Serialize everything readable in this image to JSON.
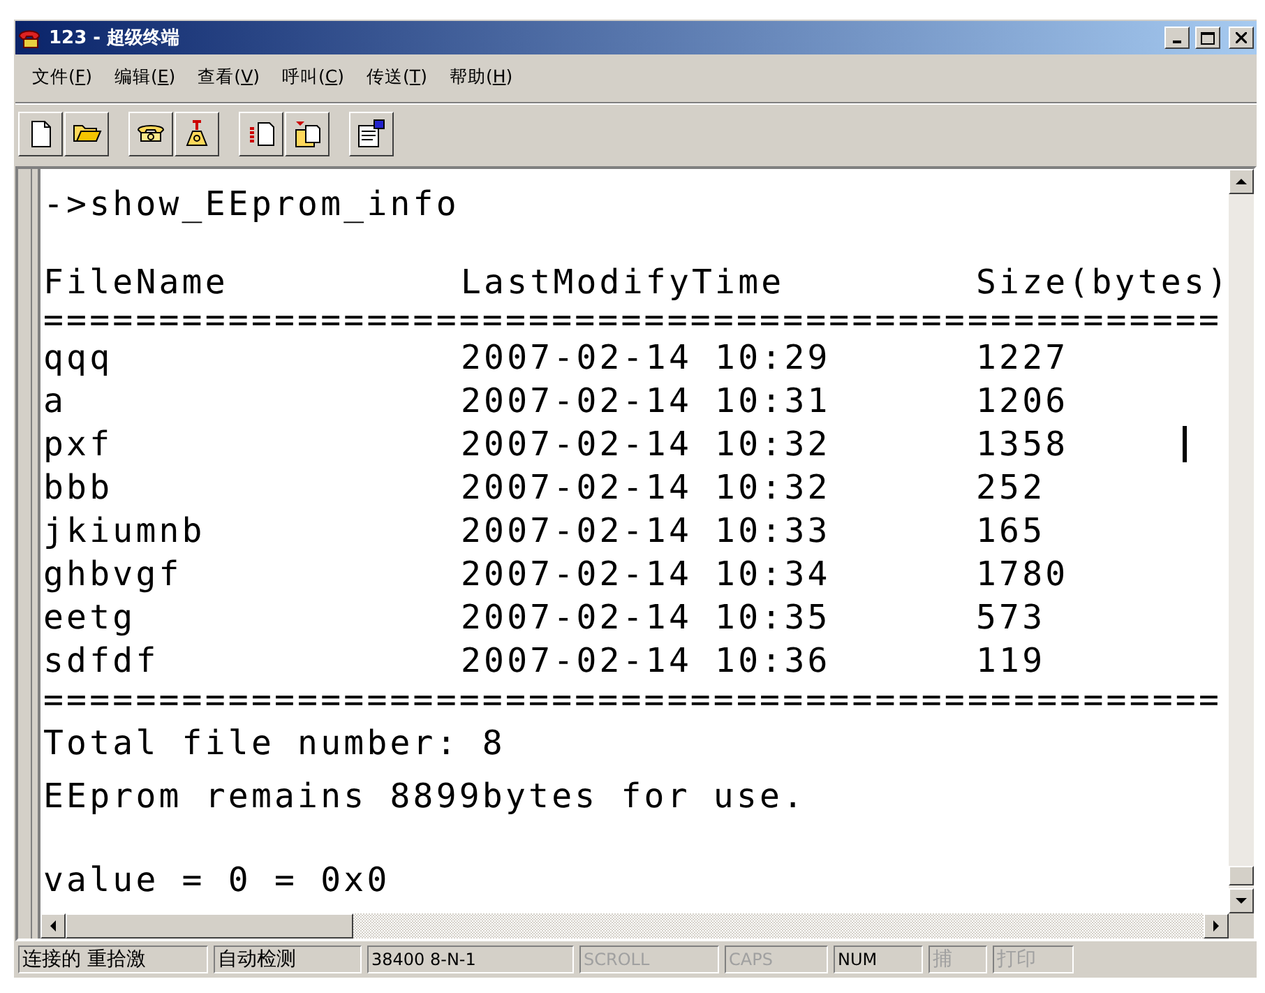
{
  "window": {
    "title": "123 - 超级终端"
  },
  "menu": [
    {
      "label": "文件(F)"
    },
    {
      "label": "编辑(E)"
    },
    {
      "label": "查看(V)"
    },
    {
      "label": "呼叫(C)"
    },
    {
      "label": "传送(T)"
    },
    {
      "label": "帮助(H)"
    }
  ],
  "terminal": {
    "lines": [
      {
        "kind": "text",
        "text": "->show_EEprom_info"
      },
      {
        "kind": "blank"
      },
      {
        "kind": "header",
        "cells": [
          "FileName",
          "LastModifyTime",
          "Size(bytes)"
        ]
      },
      {
        "kind": "rule",
        "text": "==================================================="
      },
      {
        "kind": "row",
        "cells": [
          "qqq",
          "2007-02-14 10:29",
          "1227"
        ]
      },
      {
        "kind": "row",
        "cells": [
          "a",
          "2007-02-14 10:31",
          "1206"
        ]
      },
      {
        "kind": "row",
        "cells": [
          "pxf",
          "2007-02-14 10:32",
          "1358"
        ]
      },
      {
        "kind": "row",
        "cells": [
          "bbb",
          "2007-02-14 10:32",
          "252"
        ]
      },
      {
        "kind": "row",
        "cells": [
          "jkiumnb",
          "2007-02-14 10:33",
          "165"
        ]
      },
      {
        "kind": "row",
        "cells": [
          "ghbvgf",
          "2007-02-14 10:34",
          "1780"
        ]
      },
      {
        "kind": "row",
        "cells": [
          "eetg",
          "2007-02-14 10:35",
          "573"
        ]
      },
      {
        "kind": "row",
        "cells": [
          "sdfdf",
          "2007-02-14 10:36",
          "119"
        ]
      },
      {
        "kind": "rule",
        "text": "==================================================="
      },
      {
        "kind": "text",
        "text": "Total file number: 8"
      },
      {
        "kind": "text",
        "text": "EEprom remains 8899bytes for use."
      },
      {
        "kind": "blank"
      },
      {
        "kind": "text",
        "text": "value = 0 = 0x0"
      }
    ]
  },
  "status_bar": [
    {
      "text": "连接的 重拾激",
      "disabled": false
    },
    {
      "text": "自动检测",
      "disabled": false
    },
    {
      "text": "38400 8-N-1",
      "disabled": false
    },
    {
      "text": "SCROLL",
      "disabled": true
    },
    {
      "text": "CAPS",
      "disabled": true
    },
    {
      "text": "NUM",
      "disabled": false
    },
    {
      "text": "捕",
      "disabled": true
    },
    {
      "text": "打印",
      "disabled": true
    }
  ]
}
